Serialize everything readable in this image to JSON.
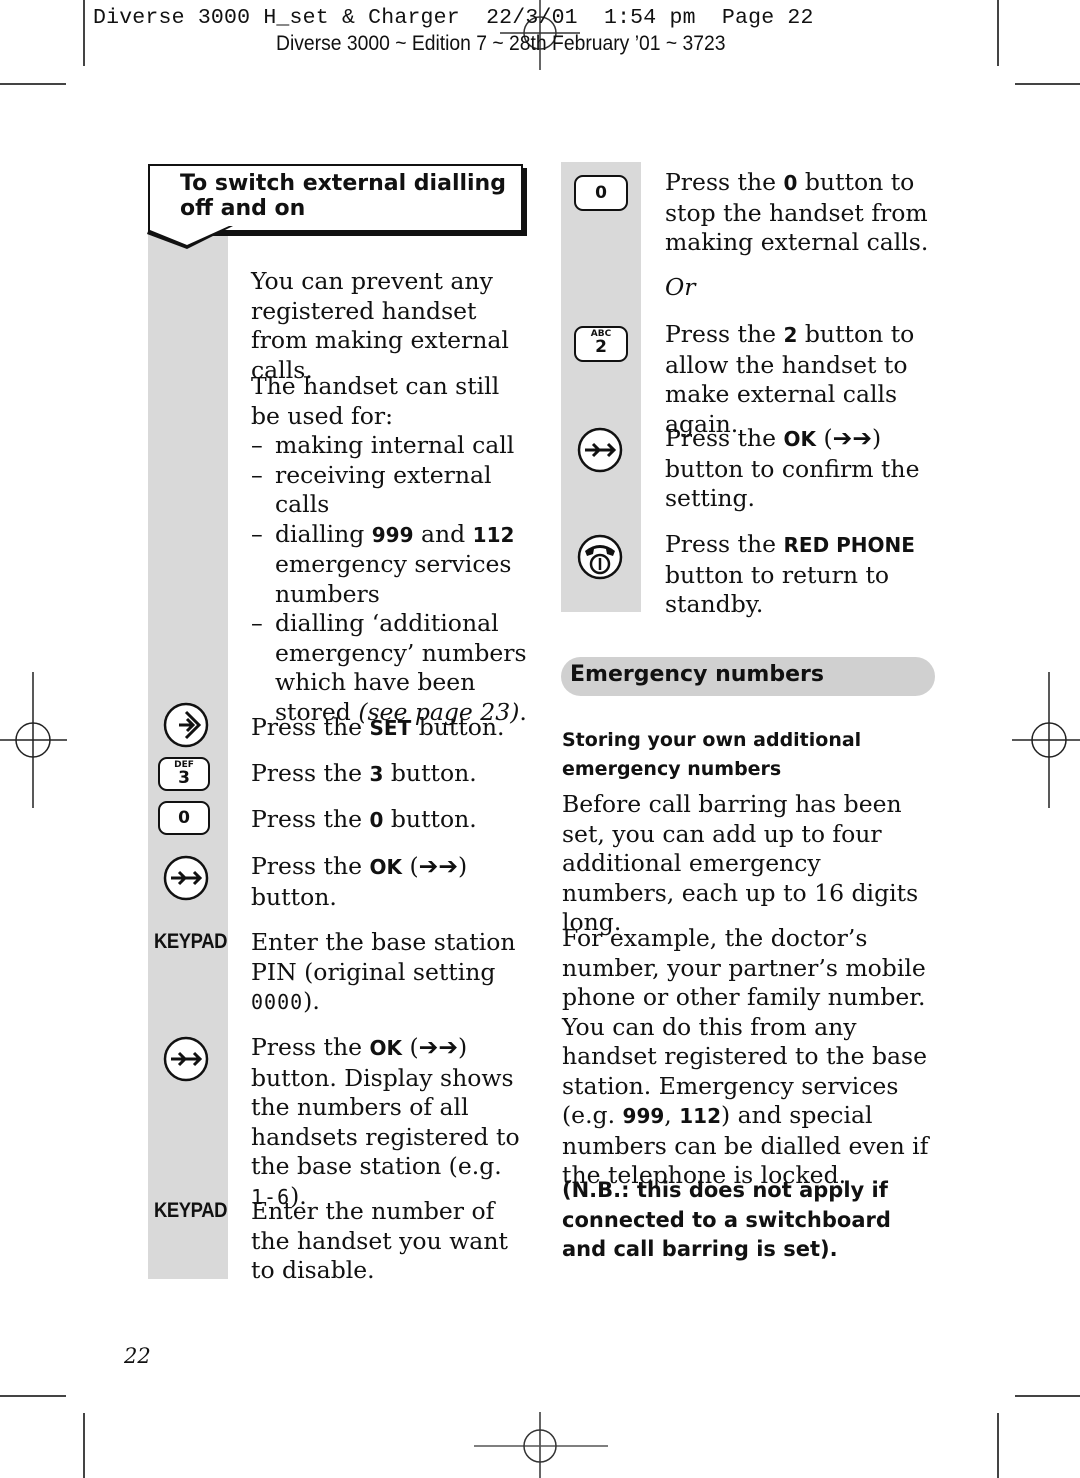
{
  "header": {
    "print_line": "Diverse 3000 H_set & Charger  22/3/01  1:54 pm  Page 22",
    "edition_line": "Diverse 3000 ~ Edition 7 ~ 28th February ’01 ~ 3723"
  },
  "left_column": {
    "section_title_line1": "To switch external dialling",
    "section_title_line2": "off and on",
    "intro": "You can prevent any registered handset from making external calls.",
    "still_used_for": "The handset can still be used for:",
    "uses": [
      {
        "text": "making internal call"
      },
      {
        "text": "receiving external calls"
      },
      {
        "pre": "dialling ",
        "bold1": "999",
        "mid": " and ",
        "bold2": "112",
        "post": " emergency services numbers"
      },
      {
        "pre": "dialling ‘additional emergency’ numbers which have been stored ",
        "italic": "(see page 23)",
        "post": "."
      }
    ],
    "steps": [
      {
        "icon": "set-button-icon",
        "pre": "Press the ",
        "bold": "SET",
        "post": " button."
      },
      {
        "icon": "key-3-icon",
        "key_sub": "DEF",
        "key_num": "3",
        "pre": "Press the ",
        "bold": "3",
        "post": " button."
      },
      {
        "icon": "key-0-icon",
        "key_num": "0",
        "pre": "Press the ",
        "bold": "0",
        "post": " button."
      },
      {
        "icon": "ok-button-icon",
        "pre": "Press the ",
        "bold": "OK",
        "arrows": " (➔➔) ",
        "post": "button."
      },
      {
        "icon_label": "KEYPAD",
        "pre": "Enter the base station PIN (original setting ",
        "lcd": "0000",
        "post": ")."
      },
      {
        "icon": "ok-button-icon",
        "pre": "Press the ",
        "bold": "OK",
        "arrows": " (➔➔) ",
        "post": "button. Display shows the numbers of all handsets registered to the base station (e.g. ",
        "lcd": "1-6",
        "post2": ")."
      },
      {
        "icon_label": "KEYPAD",
        "text": "Enter the number of the handset you want to disable."
      }
    ]
  },
  "right_column": {
    "steps": [
      {
        "icon": "key-0-icon",
        "key_num": "0",
        "pre": "Press the ",
        "bold": "0",
        "post": " button to stop the handset from making external calls."
      },
      {
        "or": "Or"
      },
      {
        "icon": "key-2-icon",
        "key_sub": "ABC",
        "key_num": "2",
        "pre": "Press the ",
        "bold": "2",
        "post": " button to allow the handset to make external calls again."
      },
      {
        "icon": "ok-button-icon",
        "pre": "Press the ",
        "bold": "OK",
        "arrows": " (➔➔) ",
        "post": "button to confirm the setting."
      },
      {
        "icon": "red-phone-icon",
        "pre": "Press the ",
        "bold": "RED PHONE",
        "post": " button to return to standby."
      }
    ],
    "emergency_heading": "Emergency numbers",
    "subheading": "Storing your own additional emergency numbers",
    "para1": "Before call barring has been set, you can add up to four additional emergency numbers, each up to 16 digits long.",
    "para2_pre": "For example, the doctor’s number, your partner’s mobile phone or other family number. You can do this from any handset registered to the base station. Emergency services (e.g. ",
    "para2_b1": "999",
    "para2_mid": ", ",
    "para2_b2": "112",
    "para2_post": ") and special numbers can be dialled even if the telephone is locked.",
    "note": "(N.B.: this does not apply if connected to a switchboard and call barring is set)."
  },
  "footer": {
    "page_number": "22"
  }
}
